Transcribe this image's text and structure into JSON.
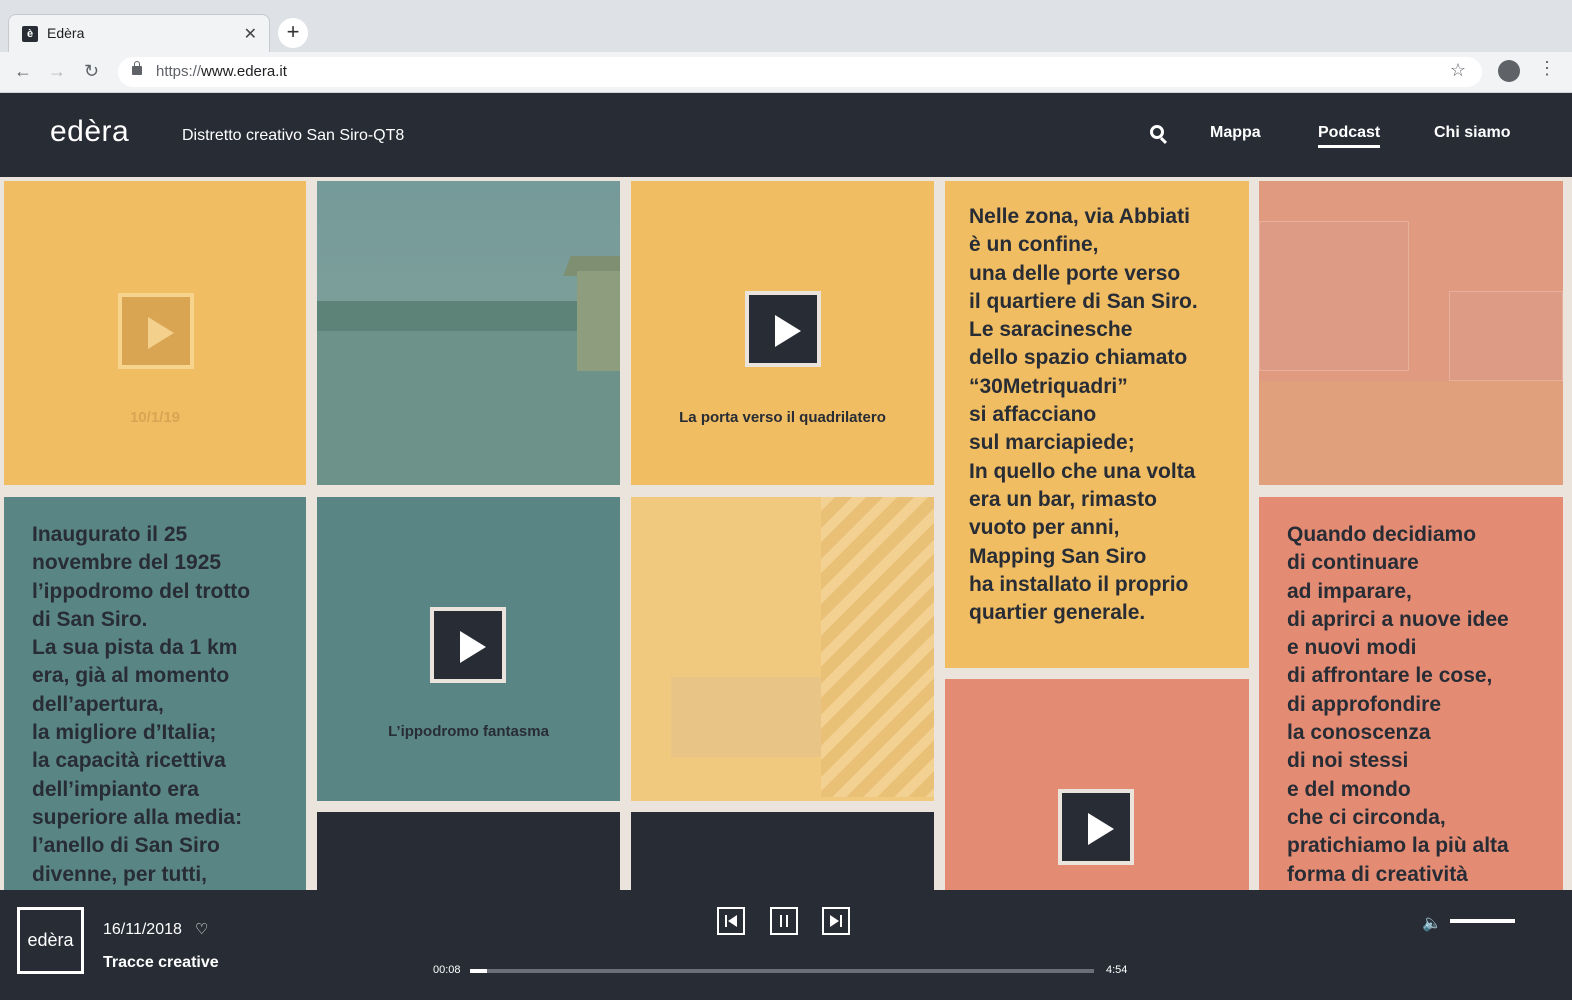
{
  "browser": {
    "tab_title": "Edèra",
    "tab_favicon": "è",
    "url_scheme": "https://",
    "url_host": "www.edera.it"
  },
  "header": {
    "logo": "edèra",
    "subtitle": "Distretto creativo San Siro-QT8",
    "nav": [
      "Mappa",
      "Podcast",
      "Chi siamo"
    ],
    "active_nav": "Podcast"
  },
  "tiles": {
    "t1_caption": "10/1/19",
    "t3_caption": "La porta verso il quadrilatero",
    "t4_text": "Nelle zona, via Abbiati\nè un confine,\nuna delle porte verso\nil quartiere di San Siro.\nLe saracinesche\ndello spazio chiamato\n“30Metriquadri”\nsi affacciano\nsul marciapiede;\nIn quello che una volta\nera un bar, rimasto\nvuoto per anni,\nMapping San Siro\nha installato il proprio\nquartier generale.",
    "t6_text": "Inaugurato il 25\nnovembre del 1925\nl’ippodromo del trotto\ndi San Siro.\nLa sua pista da 1 km\nera, già al momento\ndell’apertura,\nla migliore d’Italia;\nla capacità ricettiva\ndell’impianto era\nsuperiore alla media:\nl’anello di San Siro\ndivenne, per tutti,",
    "t7_caption": "L’ippodromo fantasma",
    "t10_text": "Quando decidiamo\ndi continuare\nad imparare,\ndi aprirci a nuove idee\ne nuovi modi\ndi affrontare le cose,\ndi approfondire\nla conoscenza\ndi noi stessi\ne del mondo\nche ci circonda,\npratichiamo la più alta\nforma di creatività"
  },
  "colors": {
    "dark": "#272c35",
    "yellow": "#f0bd63",
    "teal": "#5a8585",
    "salmon": "#e48b73",
    "cream": "#ebe4dc"
  },
  "player": {
    "logo": "edèra",
    "date": "16/11/2018",
    "title": "Tracce creative",
    "elapsed": "00:08",
    "duration": "4:54",
    "progress_fraction": 0.027,
    "volume_fraction": 1.0
  },
  "icons": [
    "search-icon",
    "heart-icon",
    "prev-icon",
    "pause-icon",
    "next-icon",
    "volume-icon",
    "play-icon",
    "star-icon",
    "lock-icon"
  ]
}
